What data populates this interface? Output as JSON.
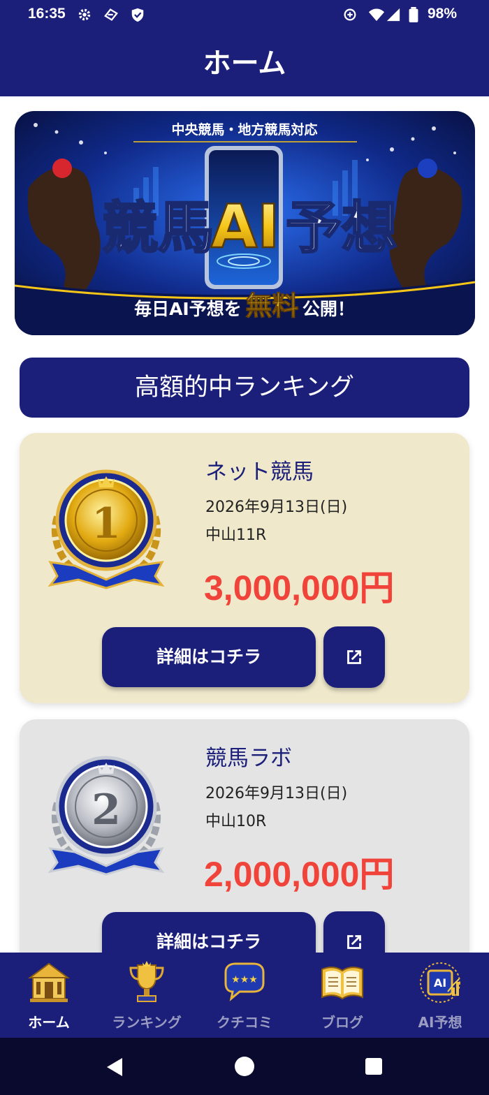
{
  "status_bar": {
    "time": "16:35",
    "battery": "98%"
  },
  "app_bar": {
    "title": "ホーム"
  },
  "banner": {
    "top_text": "中央競馬・地方競馬対応",
    "title_left": "競馬",
    "title_ai": "AI",
    "title_right": "予想",
    "bottom_pre": "毎日AI予想を",
    "bottom_highlight": "無料",
    "bottom_post": "公開！"
  },
  "ranking": {
    "header": "高額的中ランキング",
    "items": [
      {
        "rank": "1",
        "site": "ネット競馬",
        "date": "2026年9月13日(日)",
        "race": "中山11R",
        "amount": "3,000,000円",
        "detail_label": "詳細はコチラ"
      },
      {
        "rank": "2",
        "site": "競馬ラボ",
        "date": "2026年9月13日(日)",
        "race": "中山10R",
        "amount": "2,000,000円",
        "detail_label": "詳細はコチラ"
      }
    ]
  },
  "bottom_nav": {
    "items": [
      {
        "label": "ホーム",
        "icon": "home-building-icon",
        "active": true
      },
      {
        "label": "ランキング",
        "icon": "trophy-icon",
        "active": false
      },
      {
        "label": "クチコミ",
        "icon": "review-bubble-icon",
        "active": false
      },
      {
        "label": "ブログ",
        "icon": "book-icon",
        "active": false
      },
      {
        "label": "AI予想",
        "icon": "ai-chart-icon",
        "active": false
      }
    ]
  },
  "colors": {
    "primary": "#1b1f7a",
    "amount_red": "#f0443a",
    "gold_card": "#efe8cb",
    "silver_card": "#e4e4e4"
  }
}
